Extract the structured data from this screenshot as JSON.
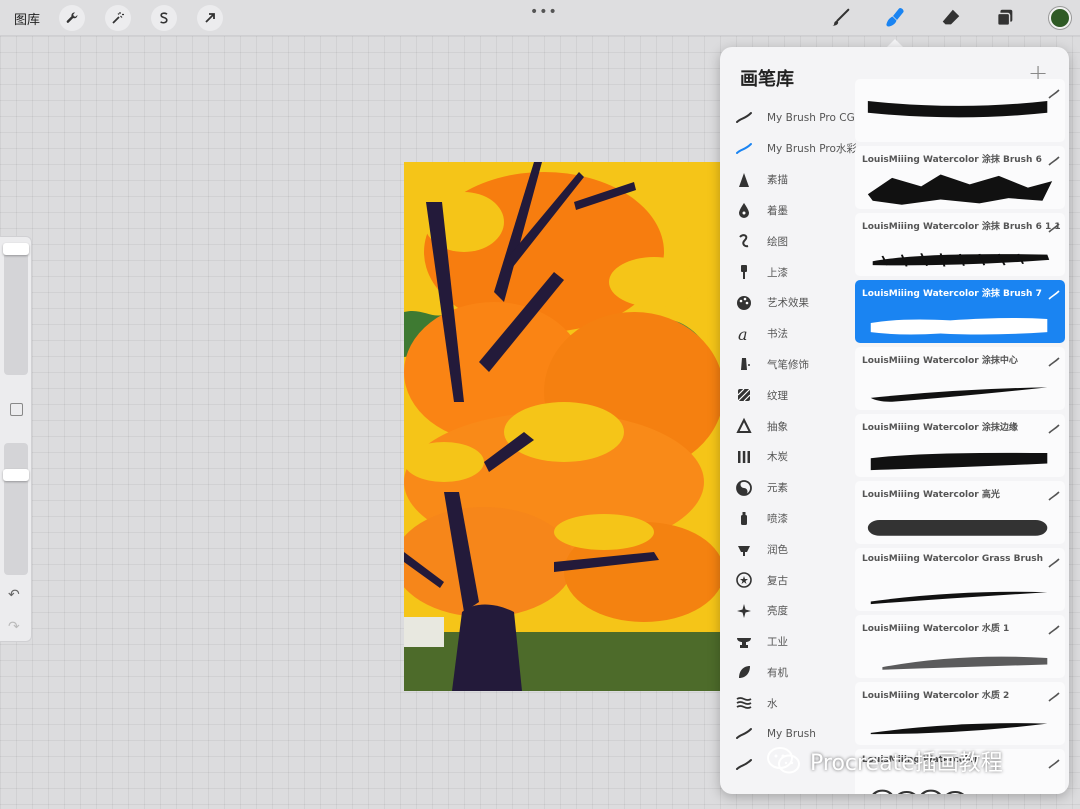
{
  "topbar": {
    "gallery_label": "图库",
    "left_tools": [
      "wrench-icon",
      "magic-wand-icon",
      "selection-s-icon",
      "transform-arrow-icon"
    ],
    "center_menu": "•••",
    "right_tools": [
      "brush-icon",
      "smudge-icon",
      "eraser-icon",
      "layers-icon"
    ],
    "active_tool": "smudge-icon",
    "current_color": "#2f5a25"
  },
  "panel": {
    "title": "画笔库",
    "add_label": "+",
    "categories": [
      {
        "label": "My Brush Pro CG",
        "icon": "brush-stroke-icon"
      },
      {
        "label": "My Brush Pro水彩",
        "icon": "brush-stroke-blue-icon",
        "active": true
      },
      {
        "label": "素描",
        "icon": "sketch-cone-icon"
      },
      {
        "label": "着墨",
        "icon": "ink-drop-icon"
      },
      {
        "label": "绘图",
        "icon": "drawing-loop-icon"
      },
      {
        "label": "上漆",
        "icon": "paint-brush-icon"
      },
      {
        "label": "艺术效果",
        "icon": "palette-icon"
      },
      {
        "label": "书法",
        "icon": "calligraphy-icon"
      },
      {
        "label": "气笔修饰",
        "icon": "airbrush-icon"
      },
      {
        "label": "纹理",
        "icon": "texture-icon"
      },
      {
        "label": "抽象",
        "icon": "abstract-triangle-icon"
      },
      {
        "label": "木炭",
        "icon": "charcoal-icon"
      },
      {
        "label": "元素",
        "icon": "elements-icon"
      },
      {
        "label": "喷漆",
        "icon": "spray-can-icon"
      },
      {
        "label": "润色",
        "icon": "retouch-icon"
      },
      {
        "label": "复古",
        "icon": "vintage-star-icon"
      },
      {
        "label": "亮度",
        "icon": "sparkle-icon"
      },
      {
        "label": "工业",
        "icon": "anvil-icon"
      },
      {
        "label": "有机",
        "icon": "leaf-icon"
      },
      {
        "label": "水",
        "icon": "water-waves-icon"
      },
      {
        "label": "My Brush",
        "icon": "brush-stroke-icon"
      },
      {
        "label": "",
        "icon": "brush-stroke-icon"
      }
    ],
    "brushes": [
      {
        "name": "",
        "stroke": "rough"
      },
      {
        "name": "LouisMiiing Watercolor 涂抹 Brush 6",
        "stroke": "blocky"
      },
      {
        "name": "LouisMiiing Watercolor 涂抹 Brush 6 1 1",
        "stroke": "spiky"
      },
      {
        "name": "LouisMiiing Watercolor 涂抹 Brush 7",
        "stroke": "wide",
        "selected": true
      },
      {
        "name": "LouisMiiing Watercolor 涂抹中心",
        "stroke": "taper"
      },
      {
        "name": "LouisMiiing Watercolor 涂抹边缘",
        "stroke": "thick-rough"
      },
      {
        "name": "LouisMiiing Watercolor 高光",
        "stroke": "texture"
      },
      {
        "name": "LouisMiiing Watercolor Grass Brush",
        "stroke": "grass"
      },
      {
        "name": "LouisMiiing Watercolor 水质 1",
        "stroke": "fade"
      },
      {
        "name": "LouisMiiing Watercolor 水质 2",
        "stroke": "taper2"
      },
      {
        "name": "LouisMiiing Watercolor",
        "stroke": "circles"
      }
    ]
  },
  "watermark": {
    "text": "Procreate插画教程",
    "icon": "wechat-icon"
  }
}
